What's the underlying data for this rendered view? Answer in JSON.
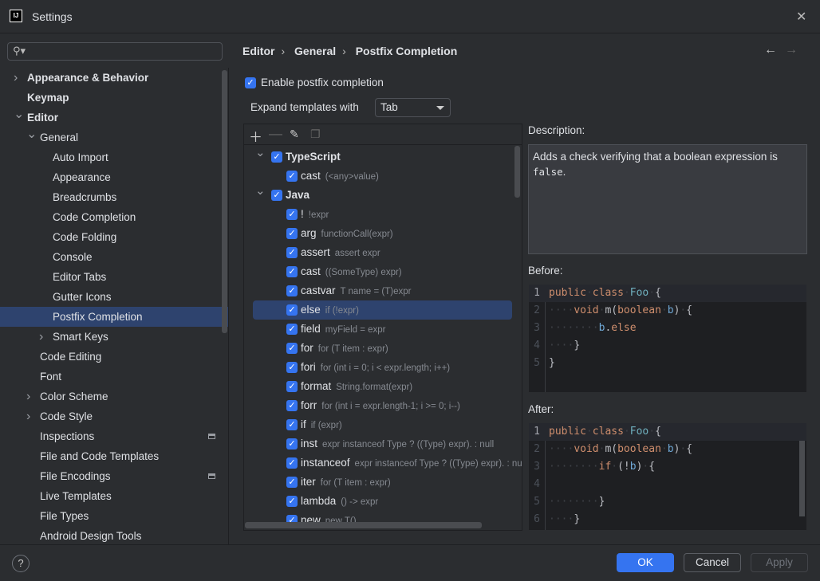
{
  "window": {
    "title": "Settings",
    "logo": "IJ"
  },
  "search": {
    "placeholder": ""
  },
  "sidebar": {
    "items": [
      {
        "label": "Appearance & Behavior",
        "level": 0,
        "chevron": "right",
        "bold": true
      },
      {
        "label": "Keymap",
        "level": 0,
        "bold": true
      },
      {
        "label": "Editor",
        "level": 0,
        "chevron": "down",
        "bold": true
      },
      {
        "label": "General",
        "level": 1,
        "chevron": "down"
      },
      {
        "label": "Auto Import",
        "level": 2
      },
      {
        "label": "Appearance",
        "level": 2
      },
      {
        "label": "Breadcrumbs",
        "level": 2
      },
      {
        "label": "Code Completion",
        "level": 2
      },
      {
        "label": "Code Folding",
        "level": 2
      },
      {
        "label": "Console",
        "level": 2
      },
      {
        "label": "Editor Tabs",
        "level": 2
      },
      {
        "label": "Gutter Icons",
        "level": 2
      },
      {
        "label": "Postfix Completion",
        "level": 2,
        "selected": true
      },
      {
        "label": "Smart Keys",
        "level": 2,
        "chevron": "right"
      },
      {
        "label": "Code Editing",
        "level": 1
      },
      {
        "label": "Font",
        "level": 1
      },
      {
        "label": "Color Scheme",
        "level": 1,
        "chevron": "right"
      },
      {
        "label": "Code Style",
        "level": 1,
        "chevron": "right"
      },
      {
        "label": "Inspections",
        "level": 1,
        "project_icon": true
      },
      {
        "label": "File and Code Templates",
        "level": 1
      },
      {
        "label": "File Encodings",
        "level": 1,
        "project_icon": true
      },
      {
        "label": "Live Templates",
        "level": 1
      },
      {
        "label": "File Types",
        "level": 1
      },
      {
        "label": "Android Design Tools",
        "level": 1
      }
    ]
  },
  "breadcrumb": [
    "Editor",
    "General",
    "Postfix Completion"
  ],
  "enable_postfix": {
    "label": "Enable postfix completion",
    "checked": true
  },
  "expand": {
    "label": "Expand templates with",
    "value": "Tab"
  },
  "toolbar": {
    "icons": [
      "add-icon",
      "remove-icon",
      "edit-icon",
      "copy-icon"
    ]
  },
  "templates": [
    {
      "key": "TypeScript",
      "group": true,
      "checked": true
    },
    {
      "key": "cast",
      "desc": "(<any>value)",
      "checked": true
    },
    {
      "key": "Java",
      "group": true,
      "checked": true
    },
    {
      "key": "!",
      "desc": "!expr",
      "checked": true
    },
    {
      "key": "arg",
      "desc": "functionCall(expr)",
      "checked": true
    },
    {
      "key": "assert",
      "desc": "assert expr",
      "checked": true
    },
    {
      "key": "cast",
      "desc": "((SomeType) expr)",
      "checked": true
    },
    {
      "key": "castvar",
      "desc": "T name = (T)expr",
      "checked": true
    },
    {
      "key": "else",
      "desc": "if (!expr)",
      "checked": true,
      "selected": true
    },
    {
      "key": "field",
      "desc": "myField = expr",
      "checked": true
    },
    {
      "key": "for",
      "desc": "for (T item : expr)",
      "checked": true
    },
    {
      "key": "fori",
      "desc": "for (int i = 0; i < expr.length; i++)",
      "checked": true
    },
    {
      "key": "format",
      "desc": "String.format(expr)",
      "checked": true
    },
    {
      "key": "forr",
      "desc": "for (int i = expr.length-1; i >= 0; i--)",
      "checked": true
    },
    {
      "key": "if",
      "desc": "if (expr)",
      "checked": true
    },
    {
      "key": "inst",
      "desc": "expr instanceof Type ? ((Type) expr). : null",
      "checked": true
    },
    {
      "key": "instanceof",
      "desc": "expr instanceof Type ? ((Type) expr). : null",
      "checked": true
    },
    {
      "key": "iter",
      "desc": "for (T item : expr)",
      "checked": true
    },
    {
      "key": "lambda",
      "desc": "() -> expr",
      "checked": true
    },
    {
      "key": "new",
      "desc": "new T()",
      "checked": true
    }
  ],
  "description": {
    "label": "Description:",
    "text": "Adds a check verifying that a boolean expression is ",
    "code": "false",
    "end": "."
  },
  "before": {
    "label": "Before:",
    "lines": [
      [
        [
          "public",
          "kw"
        ],
        [
          " ",
          "ws"
        ],
        [
          "class",
          "kw"
        ],
        [
          " ",
          "ws"
        ],
        [
          "Foo",
          "cls"
        ],
        [
          " ",
          "ws"
        ],
        [
          "{",
          "id"
        ]
      ],
      [
        [
          "    ",
          "ws"
        ],
        [
          "void",
          "kw"
        ],
        [
          " ",
          "ws"
        ],
        [
          "m(",
          "id"
        ],
        [
          "boolean",
          "kw"
        ],
        [
          " ",
          "ws"
        ],
        [
          "b",
          "var"
        ],
        [
          ")",
          "id"
        ],
        [
          " ",
          "ws"
        ],
        [
          "{",
          "id"
        ]
      ],
      [
        [
          "        ",
          "ws"
        ],
        [
          "b",
          "var"
        ],
        [
          ".",
          "id"
        ],
        [
          "else",
          "kw"
        ]
      ],
      [
        [
          "    ",
          "ws"
        ],
        [
          "}",
          "id"
        ]
      ],
      [
        [
          "}",
          "id"
        ]
      ]
    ]
  },
  "after": {
    "label": "After:",
    "lines": [
      [
        [
          "public",
          "kw"
        ],
        [
          " ",
          "ws"
        ],
        [
          "class",
          "kw"
        ],
        [
          " ",
          "ws"
        ],
        [
          "Foo",
          "cls"
        ],
        [
          " ",
          "ws"
        ],
        [
          "{",
          "id"
        ]
      ],
      [
        [
          "    ",
          "ws"
        ],
        [
          "void",
          "kw"
        ],
        [
          " ",
          "ws"
        ],
        [
          "m(",
          "id"
        ],
        [
          "boolean",
          "kw"
        ],
        [
          " ",
          "ws"
        ],
        [
          "b",
          "var"
        ],
        [
          ")",
          "id"
        ],
        [
          " ",
          "ws"
        ],
        [
          "{",
          "id"
        ]
      ],
      [
        [
          "        ",
          "ws"
        ],
        [
          "if",
          "kw"
        ],
        [
          " ",
          "ws"
        ],
        [
          "(!",
          "id"
        ],
        [
          "b",
          "var"
        ],
        [
          ")",
          "id"
        ],
        [
          " ",
          "ws"
        ],
        [
          "{",
          "id"
        ]
      ],
      [],
      [
        [
          "        ",
          "ws"
        ],
        [
          "}",
          "id"
        ]
      ],
      [
        [
          "    ",
          "ws"
        ],
        [
          "}",
          "id"
        ]
      ]
    ]
  },
  "footer": {
    "help": "?",
    "ok": "OK",
    "cancel": "Cancel",
    "apply": "Apply"
  },
  "colors": {
    "accent": "#3574f0",
    "selection": "#2e436e",
    "keyword": "#cf8e6d"
  }
}
